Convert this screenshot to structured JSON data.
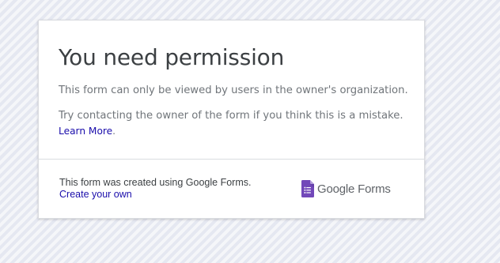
{
  "card": {
    "title": "You need permission",
    "message_1": "This form can only be viewed by users in the owner's organization.",
    "message_2": "Try contacting the owner of the form if you think this is a mistake.",
    "learn_more": "Learn More",
    "learn_more_suffix": "."
  },
  "footer": {
    "created_text": "This form was created using Google Forms.",
    "create_link": "Create your own",
    "brand_google": "Google",
    "brand_forms": "Forms",
    "icon": "google-forms-icon"
  },
  "colors": {
    "background": "#e8eaf2",
    "title": "#3c4043",
    "body_text": "#70757a",
    "link": "#1a0dab",
    "forms_purple": "#7248b9"
  }
}
